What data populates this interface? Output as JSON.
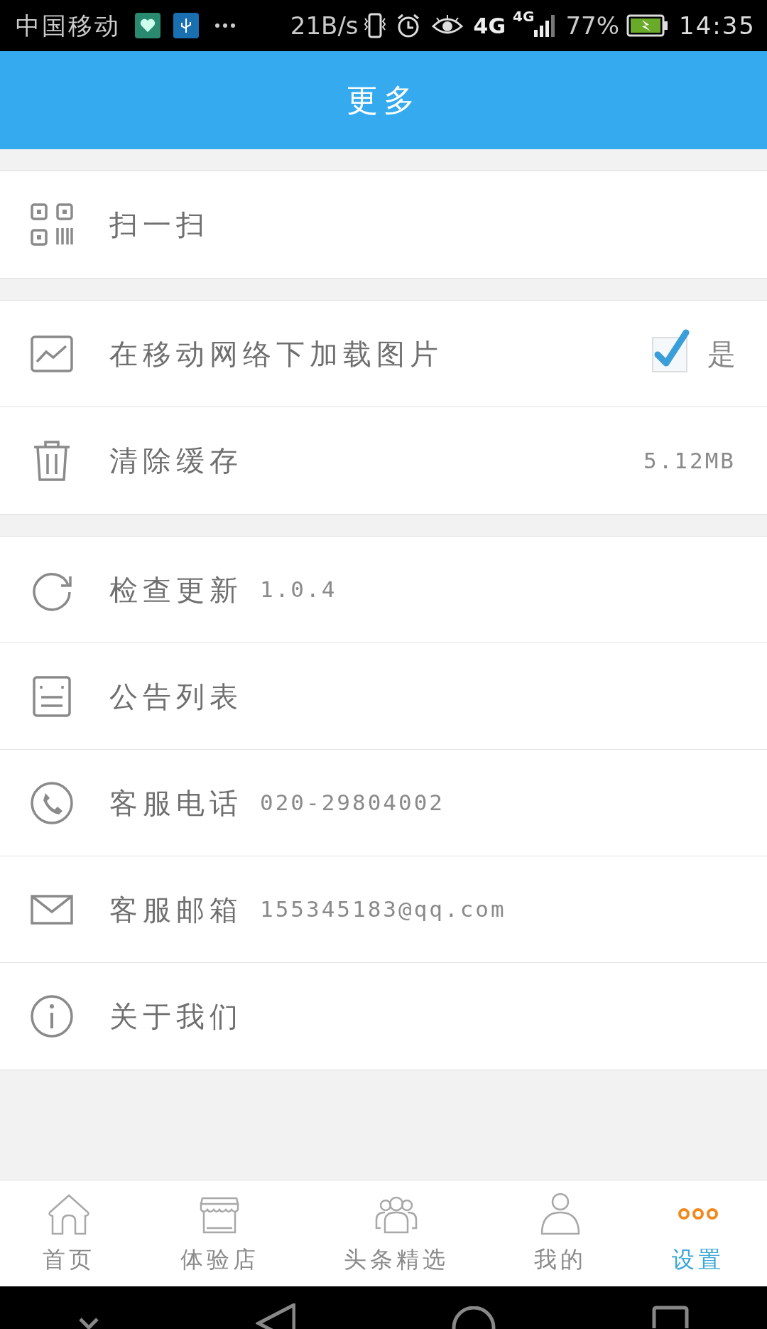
{
  "status_bar": {
    "carrier": "中国移动",
    "speed": "21B/s",
    "network_top": "4G",
    "network_signal": "4G",
    "battery": "77%",
    "time": "14:35"
  },
  "title": "更多",
  "sections": [
    [
      {
        "kind": "plain",
        "label": "扫一扫"
      }
    ],
    [
      {
        "kind": "checkbox",
        "label": "在移动网络下加载图片",
        "checked": true,
        "value": "是"
      },
      {
        "kind": "right",
        "label": "清除缓存",
        "value": "5.12MB"
      }
    ],
    [
      {
        "kind": "inline",
        "label": "检查更新",
        "value": "1.0.4"
      },
      {
        "kind": "plain",
        "label": "公告列表"
      },
      {
        "kind": "inline",
        "label": "客服电话",
        "value": "020-29804002"
      },
      {
        "kind": "inline",
        "label": "客服邮箱",
        "value": "155345183@qq.com"
      },
      {
        "kind": "plain",
        "label": "关于我们"
      }
    ]
  ],
  "tabs": [
    {
      "label": "首页",
      "selected": false
    },
    {
      "label": "体验店",
      "selected": false
    },
    {
      "label": "头条精选",
      "selected": false
    },
    {
      "label": "我的",
      "selected": false
    },
    {
      "label": "设置",
      "selected": true
    }
  ]
}
